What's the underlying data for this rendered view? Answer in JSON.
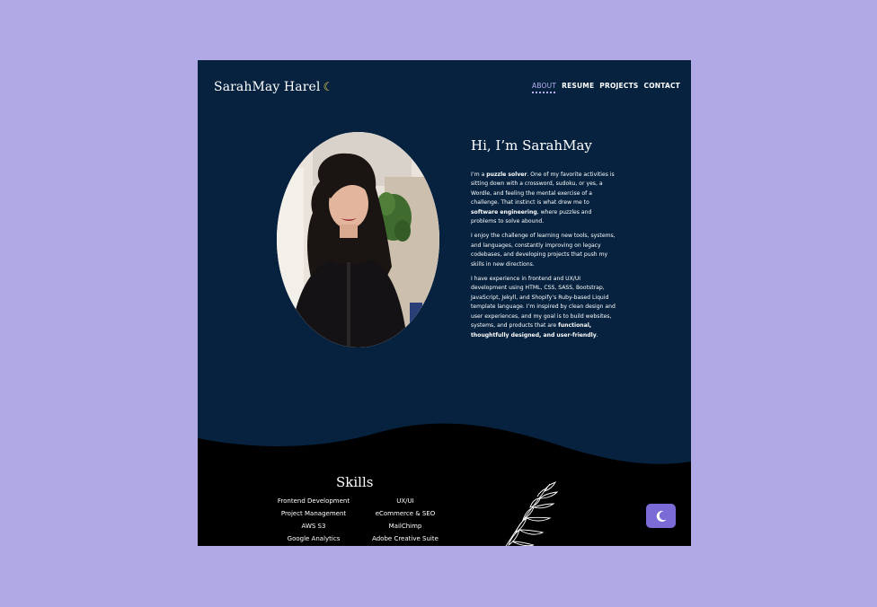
{
  "colors": {
    "page_bg": "#b1a8e6",
    "site_bg": "#06223f",
    "footer_bg": "#000000",
    "accent": "#7a6bd6"
  },
  "header": {
    "logo_text": "SarahMay Harel",
    "logo_icon": "crescent-moon-icon"
  },
  "nav": {
    "items": [
      {
        "label": "ABOUT"
      },
      {
        "label": "RESUME"
      },
      {
        "label": "PROJECTS"
      },
      {
        "label": "CONTACT"
      }
    ]
  },
  "about": {
    "heading": "Hi, I’m SarahMay",
    "p1_a": "I’m a ",
    "p1_b": "puzzle solver",
    "p1_c": ". One of my favorite activities is sitting down with a crossword, sudoku, or yes, a Wordle, and feeling the mental exercise of a challenge. That instinct is what drew me to ",
    "p1_d": "software engineering",
    "p1_e": ", where puzzles and problems to solve abound.",
    "p2": "I enjoy the challenge of learning new tools, systems, and languages, constantly improving on legacy codebases, and developing projects that push my skills in new directions.",
    "p3_a": "I have experience in frontend and UX/UI development using HTML, CSS, SASS, Bootstrap, JavaScript, Jekyll, and Shopify’s Ruby-based Liquid template language. I’m inspired by clean design and user experiences, and my goal is to build websites, systems, and products that are ",
    "p3_b": "functional, thoughtfully designed, and user-friendly",
    "p3_c": "."
  },
  "skills": {
    "title": "Skills",
    "items": [
      "Frontend Development",
      "UX/UI",
      "Project Management",
      "eCommerce & SEO",
      "AWS S3",
      "MailChimp",
      "Google Analytics",
      "Adobe Creative Suite"
    ]
  },
  "theme_toggle": {
    "icon": "moon-icon"
  }
}
